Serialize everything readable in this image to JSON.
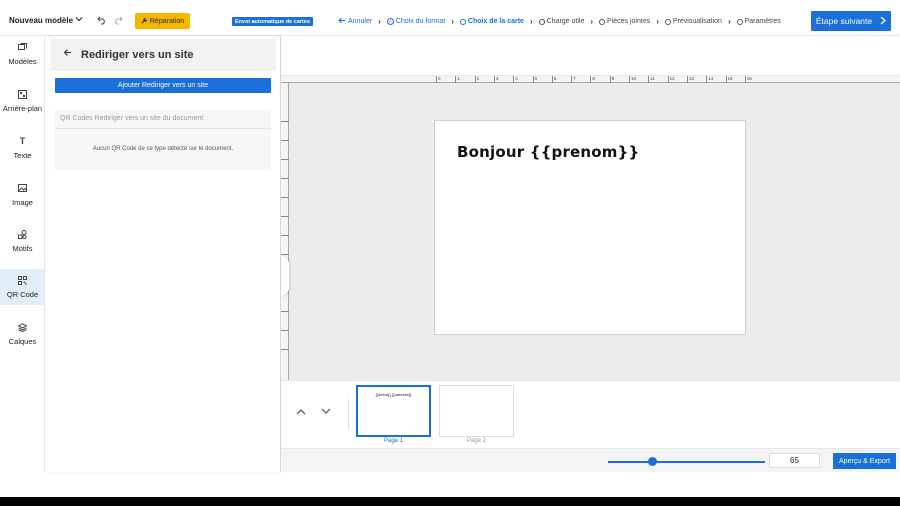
{
  "topbar": {
    "doc_title": "Nouveau modèle",
    "repair_label": "Réparation",
    "auto_badge": "Envoi automatique de cartes",
    "steps": [
      {
        "label": "Annuler"
      },
      {
        "label": "Choix du format"
      },
      {
        "label": "Choix de la carte"
      },
      {
        "label": "Charge utile"
      },
      {
        "label": "Pièces jointes"
      },
      {
        "label": "Prévisualisation"
      },
      {
        "label": "Paramètres"
      }
    ],
    "next_label": "Étape suivante"
  },
  "leftnav": {
    "items": [
      {
        "label": "Modèles",
        "icon": "templates-icon"
      },
      {
        "label": "Arrière-plan",
        "icon": "background-icon"
      },
      {
        "label": "Texte",
        "icon": "text-icon"
      },
      {
        "label": "Image",
        "icon": "image-icon"
      },
      {
        "label": "Motifs",
        "icon": "shapes-icon"
      },
      {
        "label": "QR Code",
        "icon": "qr-code-icon"
      },
      {
        "label": "Calques",
        "icon": "layers-icon"
      }
    ],
    "active": "QR Code"
  },
  "panel": {
    "title": "Rediriger vers un site",
    "add_button": "Ajouter Rediriger vers un site",
    "list_header": "QR Codes Rediriger vers un site du document",
    "empty_message": "Aucun QR Code de ce type détecté sur le document."
  },
  "ruler": {
    "ticks": [
      "0",
      "1",
      "2",
      "3",
      "4",
      "5",
      "6",
      "7",
      "8",
      "9",
      "10",
      "11",
      "12",
      "13",
      "14",
      "15",
      "16"
    ]
  },
  "canvas": {
    "text": "Bonjour {{prenom}}"
  },
  "pages": {
    "items": [
      {
        "label": "Page 1",
        "preview_text": "{{début}} {{adresse}}"
      },
      {
        "label": "Page 2",
        "preview_text": ""
      }
    ]
  },
  "zoom": {
    "value": "65",
    "level": 0.28,
    "export_label": "Aperçu & Export"
  },
  "colors": {
    "accent": "#1a6fd8",
    "repair": "#f5b800"
  }
}
